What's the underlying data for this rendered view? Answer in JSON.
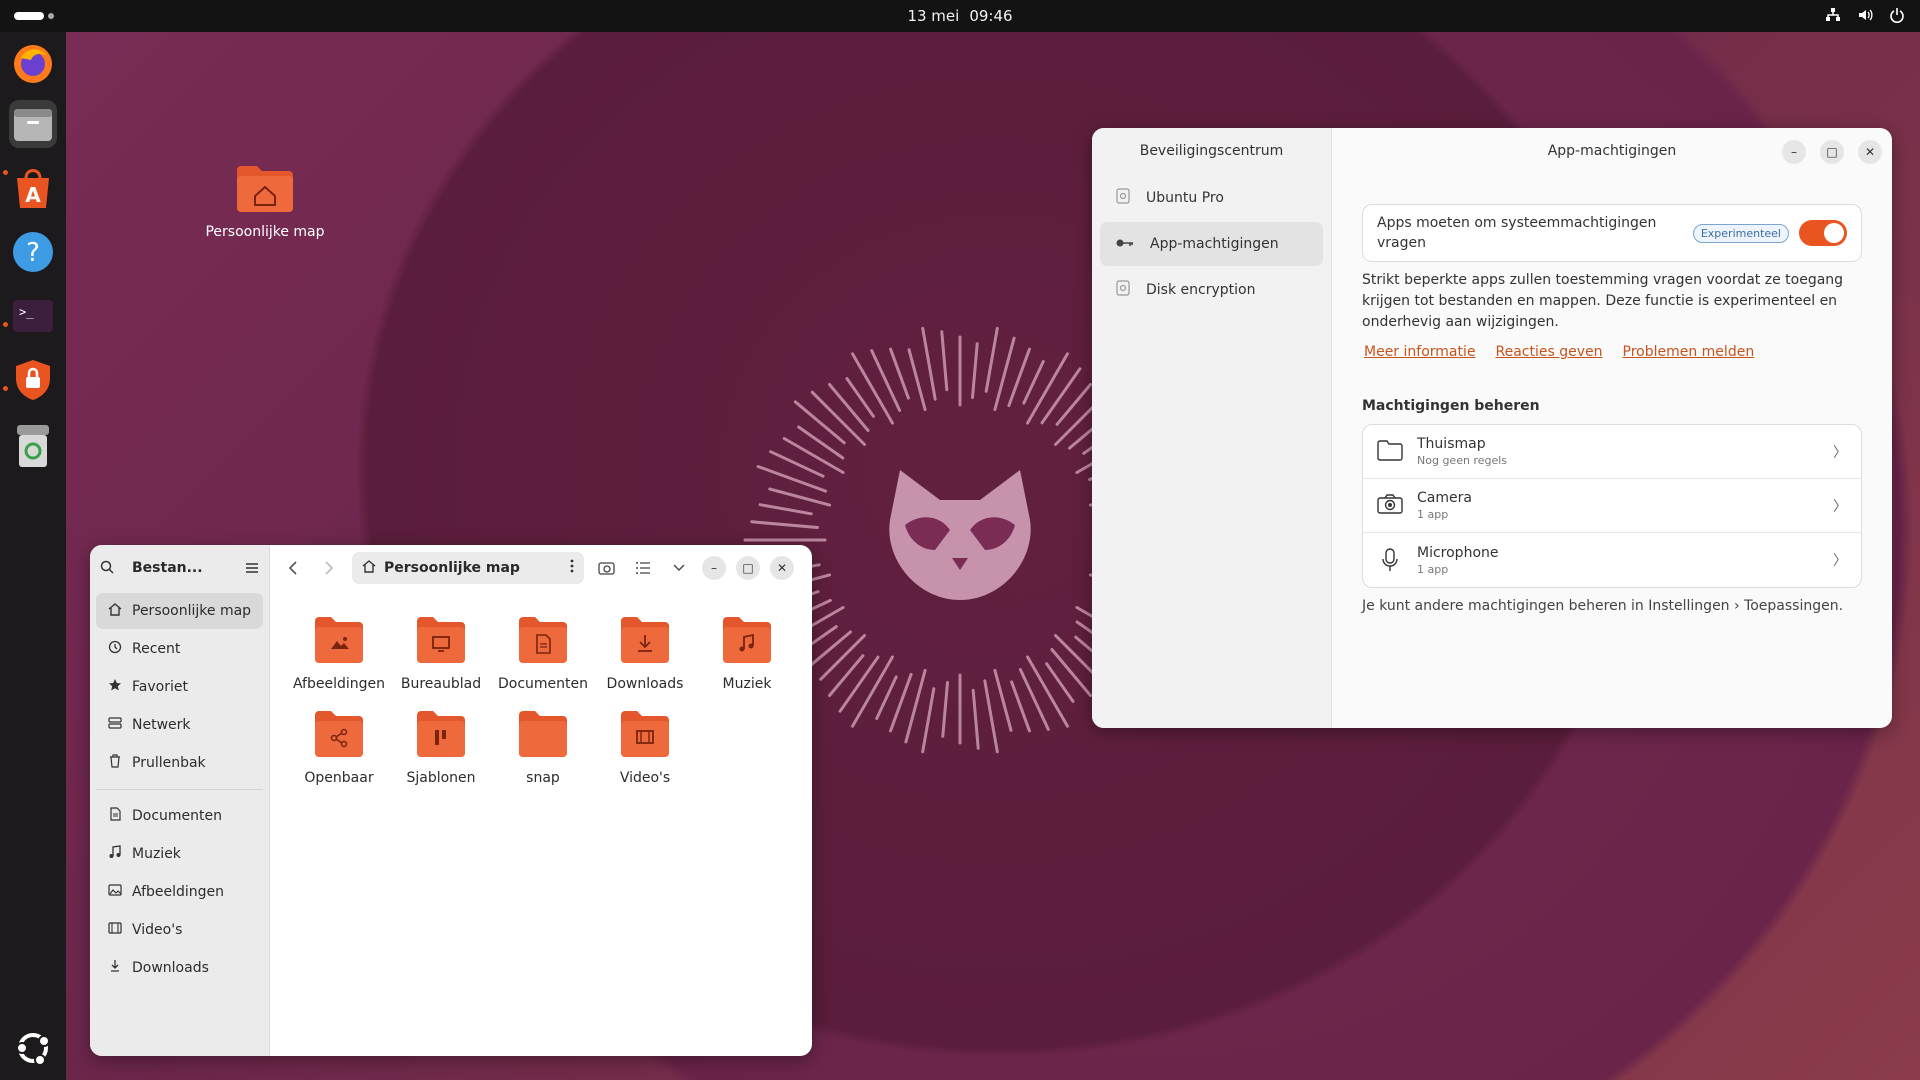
{
  "topbar": {
    "date": "13 mei",
    "time": "09:46"
  },
  "desktop": {
    "home_icon_label": "Persoonlijke map"
  },
  "files": {
    "sidebar_title": "Bestan...",
    "path": "Persoonlijke map",
    "sidebar_items": [
      {
        "label": "Persoonlijke map",
        "icon": "home-icon"
      },
      {
        "label": "Recent",
        "icon": "clock-icon"
      },
      {
        "label": "Favoriet",
        "icon": "star-icon"
      },
      {
        "label": "Netwerk",
        "icon": "network-icon"
      },
      {
        "label": "Prullenbak",
        "icon": "trash-icon"
      }
    ],
    "bookmarks": [
      {
        "label": "Documenten",
        "icon": "document-icon"
      },
      {
        "label": "Muziek",
        "icon": "music-icon"
      },
      {
        "label": "Afbeeldingen",
        "icon": "image-icon"
      },
      {
        "label": "Video's",
        "icon": "film-icon"
      },
      {
        "label": "Downloads",
        "icon": "download-icon"
      }
    ],
    "folders": [
      {
        "label": "Afbeeldingen",
        "icon": "image-icon"
      },
      {
        "label": "Bureaublad",
        "icon": "desktop-icon"
      },
      {
        "label": "Documenten",
        "icon": "document-icon"
      },
      {
        "label": "Downloads",
        "icon": "download-icon"
      },
      {
        "label": "Muziek",
        "icon": "music-icon"
      },
      {
        "label": "Openbaar",
        "icon": "share-icon"
      },
      {
        "label": "Sjablonen",
        "icon": "template-icon"
      },
      {
        "label": "snap",
        "icon": "folder-icon"
      },
      {
        "label": "Video's",
        "icon": "film-icon"
      }
    ]
  },
  "security": {
    "sidebar_title": "Beveiligingscentrum",
    "nav": [
      {
        "label": "Ubuntu Pro"
      },
      {
        "label": "App-machtigingen"
      },
      {
        "label": "Disk encryption"
      }
    ],
    "page_title": "App-machtigingen",
    "toggle_text": "Apps moeten om systeemmachtigingen vragen",
    "badge": "Experimenteel",
    "description": "Strikt beperkte apps zullen toestemming vragen voordat ze toegang krijgen tot bestanden en mappen. Deze functie is experimenteel en onderhevig aan wijzigingen.",
    "links": [
      "Meer informatie",
      "Reacties geven",
      "Problemen melden"
    ],
    "section_title": "Machtigingen beheren",
    "permissions": [
      {
        "title": "Thuismap",
        "sub": "Nog geen regels"
      },
      {
        "title": "Camera",
        "sub": "1 app"
      },
      {
        "title": "Microphone",
        "sub": "1 app"
      }
    ],
    "footnote": "Je kunt andere machtigingen beheren in Instellingen › Toepassingen."
  },
  "colors": {
    "accent": "#e95420",
    "folder": "#e4562c",
    "link": "#c7531c"
  }
}
